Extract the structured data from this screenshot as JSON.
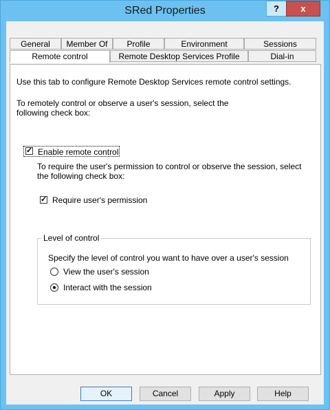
{
  "window": {
    "title": "SRed Properties",
    "help_label": "?",
    "close_label": "x"
  },
  "tabs_row1": [
    "General",
    "Member Of",
    "Profile",
    "Environment",
    "Sessions"
  ],
  "tabs_row2": [
    "Remote control",
    "Remote Desktop Services Profile",
    "Dial-in"
  ],
  "active_tab": "Remote control",
  "panel": {
    "intro": "Use this tab to configure Remote Desktop Services remote control settings.",
    "instruction1": "To remotely control or observe a user's session, select the following check box:",
    "enable_checkbox_label": "Enable remote control",
    "enable_checked": true,
    "instruction2": "To require the user's permission to control or observe the session, select the following check box:",
    "require_checkbox_label": "Require user's permission",
    "require_checked": true,
    "group_title": "Level of control",
    "group_instruction": "Specify the level of control you want to have over a user's session",
    "radio_view_label": "View the user's session",
    "radio_interact_label": "Interact with the session",
    "selected_level": "interact"
  },
  "buttons": {
    "ok": "OK",
    "cancel": "Cancel",
    "apply": "Apply",
    "help": "Help"
  },
  "colors": {
    "title_bar": "#6cc1f0",
    "close_button": "#c75050",
    "dialog_bg": "#f0f0f0"
  }
}
